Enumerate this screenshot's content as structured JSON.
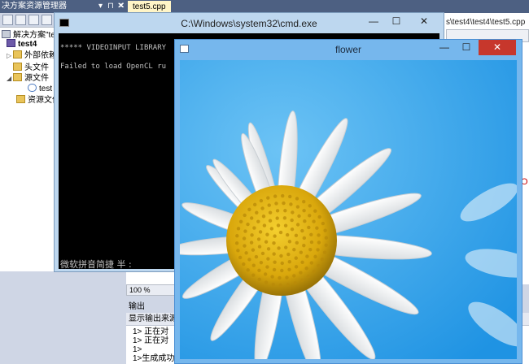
{
  "solution_explorer": {
    "title": "决方案资源管理器",
    "title_controls": [
      "▾",
      "⊓",
      "✕"
    ],
    "tree": [
      {
        "label": "解决方案\"teste",
        "icon": "solution-icon",
        "arrow": ""
      },
      {
        "label": "test4",
        "icon": "project-icon",
        "arrow": ""
      },
      {
        "label": "外部依赖",
        "icon": "folder-icon",
        "arrow": "▷"
      },
      {
        "label": "头文件",
        "icon": "folder-icon",
        "arrow": ""
      },
      {
        "label": "源文件",
        "icon": "folder-icon",
        "arrow": "◢"
      },
      {
        "label": "test",
        "icon": "cpp-file-icon",
        "arrow": ""
      },
      {
        "label": "资源文件",
        "icon": "folder-icon",
        "arrow": ""
      }
    ]
  },
  "editor": {
    "tab_label": "test5.cpp",
    "tab_close": "✕",
    "path": "s\\test4\\test4\\test5.cpp",
    "zoom": "100 %",
    "red_mark": "O"
  },
  "output": {
    "title": "输出",
    "show_label": "显示输出来源",
    "lines": [
      "1>  正在对",
      "1>  正在对",
      "1>",
      "1>生成成功"
    ]
  },
  "cmd_window": {
    "title": "C:\\Windows\\system32\\cmd.exe",
    "minimize": "—",
    "maximize": "☐",
    "close": "✕",
    "console_lines": [
      "***** VIDEOINPUT LIBRARY",
      "Failed to load OpenCL ru",
      "微软拼音简捷 半 :"
    ]
  },
  "flower_window": {
    "title": "flower",
    "minimize": "—",
    "maximize": "☐",
    "close": "✕"
  },
  "colors": {
    "vs_title_bar": "#4d6082",
    "cmd_frame": "#bdd7ef",
    "flower_frame": "#76b7ed",
    "close_red": "#c7372c",
    "sky_blue": "#39a7ef",
    "petal_white": "#f8f8f5",
    "center_yellow": "#e5b516"
  }
}
